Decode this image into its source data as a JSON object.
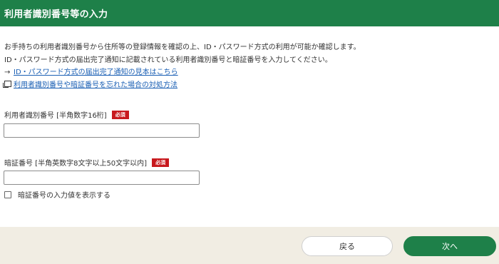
{
  "header": {
    "title": "利用者識別番号等の入力"
  },
  "intro": {
    "line1": "お手持ちの利用者識別番号から住所等の登録情報を確認の上、ID・パスワード方式の利用が可能か確認します。",
    "line2": "ID・パスワード方式の届出完了通知に記載されている利用者識別番号と暗証番号を入力してください。"
  },
  "links": {
    "sample": {
      "icon": "arrow-right-icon",
      "label": "ID・パスワード方式の届出完了通知の見本はこちら"
    },
    "forgot": {
      "icon": "external-window-icon",
      "label": "利用者識別番号や暗証番号を忘れた場合の対処方法"
    }
  },
  "fields": {
    "user_id": {
      "label": "利用者識別番号 [半角数字16桁]",
      "badge": "必須",
      "value": "",
      "placeholder": ""
    },
    "password": {
      "label": "暗証番号 [半角英数字8文字以上50文字以内]",
      "badge": "必須",
      "value": "",
      "placeholder": ""
    }
  },
  "show_password": {
    "label": "暗証番号の入力値を表示する",
    "checked": false
  },
  "buttons": {
    "back": "戻る",
    "next": "次へ"
  },
  "colors": {
    "primary": "#1e8049",
    "required_badge": "#c8191e",
    "link": "#1a5fb4",
    "footer_bg": "#f1ede3"
  }
}
